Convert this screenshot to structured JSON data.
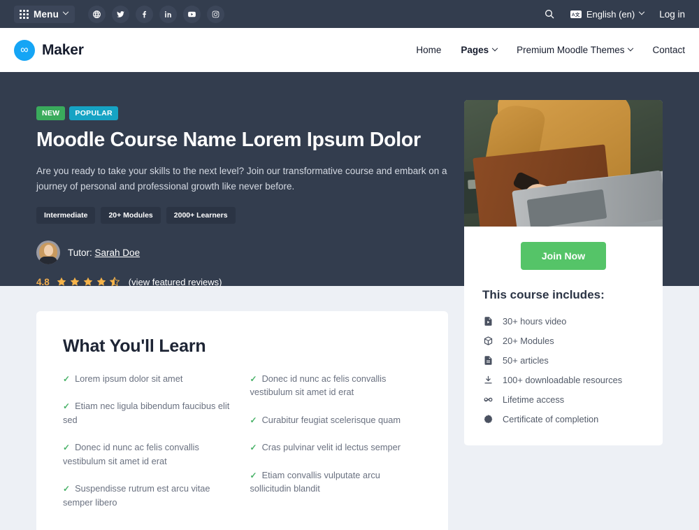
{
  "topbar": {
    "menu_label": "Menu",
    "menu_icon": "grid-icon",
    "socials": [
      {
        "name": "globe-icon",
        "title": "Website"
      },
      {
        "name": "twitter-icon",
        "title": "Twitter"
      },
      {
        "name": "facebook-icon",
        "title": "Facebook"
      },
      {
        "name": "linkedin-icon",
        "title": "LinkedIn"
      },
      {
        "name": "youtube-icon",
        "title": "YouTube"
      },
      {
        "name": "instagram-icon",
        "title": "Instagram"
      }
    ],
    "search_icon": "search-icon",
    "lang_badge": "A文",
    "language": "English (en)",
    "login": "Log in"
  },
  "header": {
    "brand_mark": "∞",
    "brand_name": "Maker",
    "nav": [
      {
        "label": "Home",
        "caret": false,
        "active": false
      },
      {
        "label": "Pages",
        "caret": true,
        "active": true
      },
      {
        "label": "Premium Moodle Themes",
        "caret": true,
        "active": false
      },
      {
        "label": "Contact",
        "caret": false,
        "active": false
      }
    ]
  },
  "hero": {
    "badges": [
      {
        "label": "NEW",
        "color": "#3aab5c"
      },
      {
        "label": "POPULAR",
        "color": "#16a3c4"
      }
    ],
    "title": "Moodle Course Name Lorem Ipsum Dolor",
    "description": "Are you ready to take your skills to the next level? Join our transformative course and embark on a journey of personal and professional growth like never before.",
    "tags": [
      "Intermediate",
      "20+ Modules",
      "2000+ Learners"
    ],
    "tutor_prefix": "Tutor:",
    "tutor_name": "Sarah Doe",
    "rating_value": "4.8",
    "stars_full": 4,
    "stars_half": 1,
    "reviews_link": "(view featured reviews)",
    "bg_color": "#333d4e"
  },
  "side_card": {
    "image_alt": "person typing on laptop",
    "join_label": "Join Now",
    "join_color": "#55c468",
    "includes_title": "This course includes:",
    "includes": [
      {
        "icon": "video-file-icon",
        "label": "30+ hours video"
      },
      {
        "icon": "box-icon",
        "label": "20+ Modules"
      },
      {
        "icon": "document-icon",
        "label": "50+ articles"
      },
      {
        "icon": "download-icon",
        "label": "100+ downloadable resources"
      },
      {
        "icon": "infinity-icon",
        "label": "Lifetime access"
      },
      {
        "icon": "certificate-icon",
        "label": "Certificate of completion"
      }
    ]
  },
  "main_card": {
    "title": "What You'll Learn",
    "tick": "✓",
    "column_left": [
      "Lorem ipsum dolor sit amet",
      "Etiam nec ligula bibendum faucibus elit sed",
      "Donec id nunc ac felis convallis vestibulum sit amet id erat",
      "Suspendisse rutrum est arcu vitae semper libero"
    ],
    "column_right": [
      "Donec id nunc ac felis convallis vestibulum sit amet id erat",
      "Curabitur feugiat scelerisque quam",
      "Cras pulvinar velit id lectus semper",
      "Etiam convallis vulputate arcu sollicitudin blandit"
    ]
  }
}
